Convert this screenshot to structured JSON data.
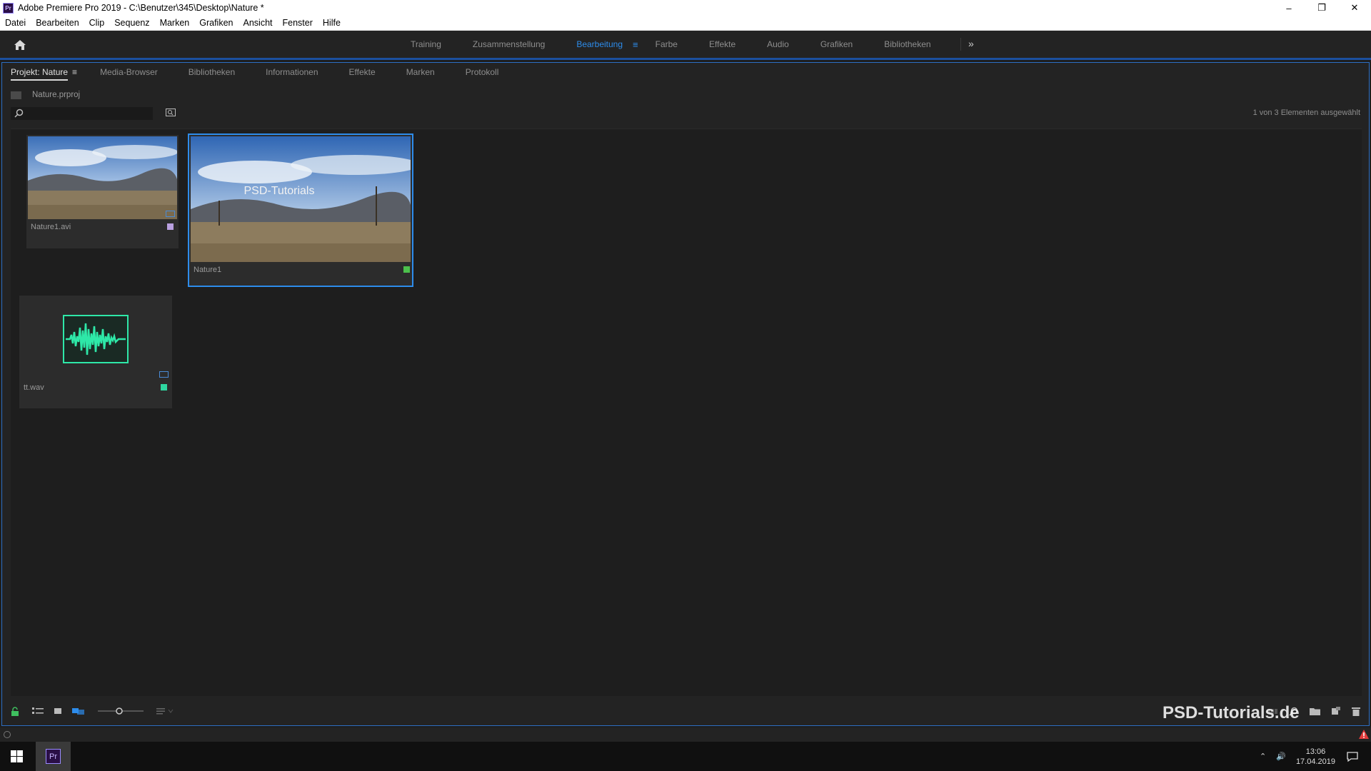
{
  "window": {
    "title": "Adobe Premiere Pro 2019 - C:\\Benutzer\\345\\Desktop\\Nature *",
    "app_icon": "Pr",
    "controls": {
      "minimize": "–",
      "restore": "❐",
      "close": "✕"
    }
  },
  "menu": [
    "Datei",
    "Bearbeiten",
    "Clip",
    "Sequenz",
    "Marken",
    "Grafiken",
    "Ansicht",
    "Fenster",
    "Hilfe"
  ],
  "workspaces": {
    "tabs": [
      "Training",
      "Zusammenstellung",
      "Bearbeitung",
      "Farbe",
      "Effekte",
      "Audio",
      "Grafiken",
      "Bibliotheken"
    ],
    "active": "Bearbeitung",
    "menu_icon": "≡",
    "more_icon": "»"
  },
  "panel": {
    "tabs": [
      "Projekt: Nature",
      "Media-Browser",
      "Bibliotheken",
      "Informationen",
      "Effekte",
      "Marken",
      "Protokoll"
    ],
    "active": "Projekt: Nature",
    "menu_icon": "≡",
    "project_file": "Nature.prproj",
    "search_placeholder": "",
    "selection_count": "1 von 3 Elementen ausgewählt"
  },
  "items": [
    {
      "name": "Nature1.avi",
      "type": "video",
      "label_color": "#b9a0e0",
      "selected": false
    },
    {
      "name": "Nature1",
      "type": "sequence",
      "label_color": "#4cc04c",
      "selected": true,
      "overlay_text": "PSD-Tutorials"
    },
    {
      "name": "tt.wav",
      "type": "audio",
      "label_color": "#2ed6a0",
      "selected": false
    }
  ],
  "colors": {
    "accent": "#2d8ceb",
    "panel_border": "#2d6fc4",
    "waveform": "#2ee8a8"
  },
  "taskbar": {
    "app": "Pr",
    "time": "13:06",
    "date": "17.04.2019"
  },
  "watermark": "PSD-Tutorials.de"
}
